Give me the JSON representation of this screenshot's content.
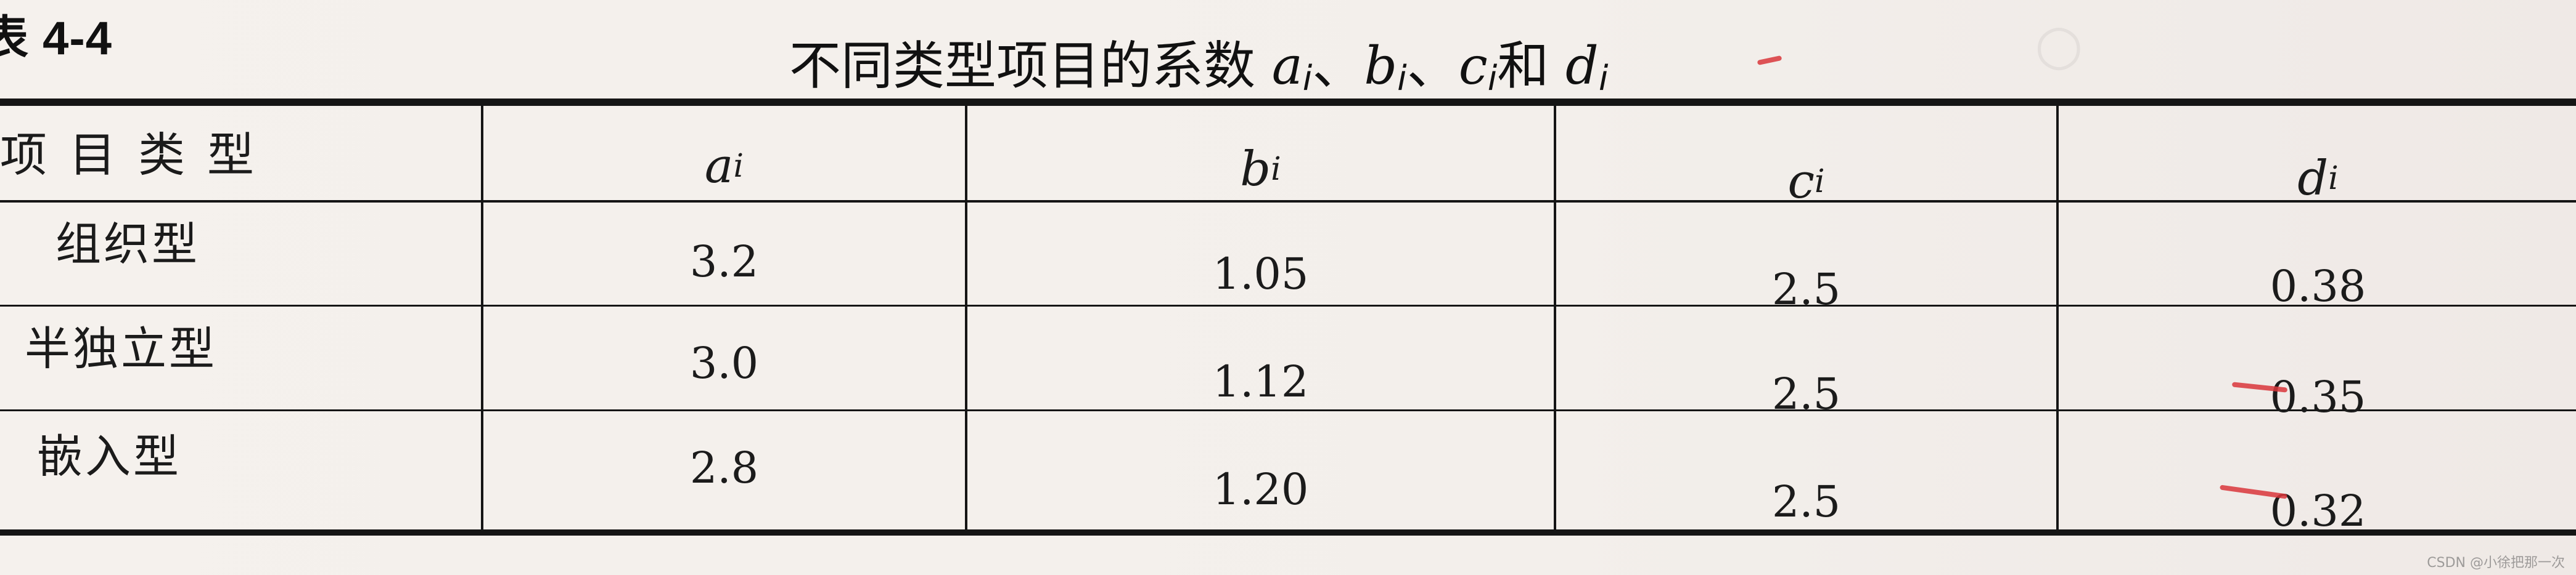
{
  "table_label": "表 4-4",
  "title": {
    "prefix": "不同类型项目的系数 ",
    "a": "a",
    "sub_i": "i",
    "sep": "、",
    "b": "b",
    "c": "c",
    "and": "和 ",
    "d": "d"
  },
  "header": {
    "type": "项目类型",
    "columns": [
      {
        "var": "a",
        "sub": "i"
      },
      {
        "var": "b",
        "sub": "i"
      },
      {
        "var": "c",
        "sub": "i"
      },
      {
        "var": "d",
        "sub": "i"
      }
    ]
  },
  "rows": [
    {
      "label": "组织型",
      "a": "3.2",
      "b": "1.05",
      "c": "2.5",
      "d": "0.38"
    },
    {
      "label": "半独立型",
      "a": "3.0",
      "b": "1.12",
      "c": "2.5",
      "d": "0.35"
    },
    {
      "label": "嵌入型",
      "a": "2.8",
      "b": "1.20",
      "c": "2.5",
      "d": "0.32"
    }
  ],
  "watermark": "CSDN @小徐把那一次",
  "colors": {
    "ink": "#151515",
    "pen": "#d9363b",
    "paper": "#f3efeb"
  }
}
